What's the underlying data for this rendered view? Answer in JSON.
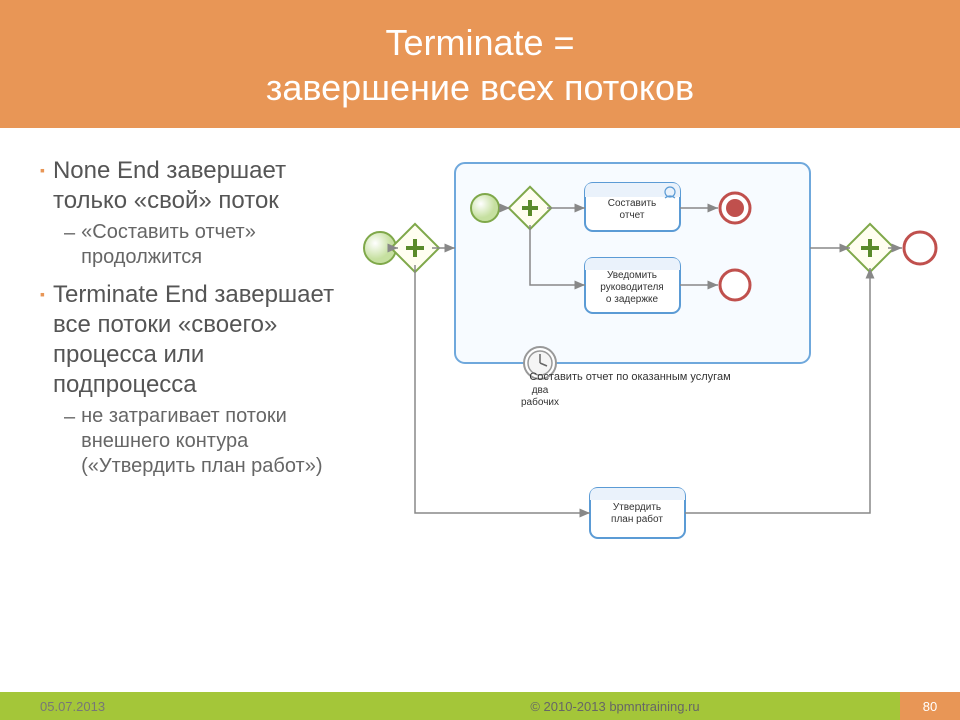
{
  "header": {
    "line1": "Terminate =",
    "line2": "завершение всех потоков"
  },
  "bullets": {
    "b1": "None End завершает только «свой» поток",
    "s1": "«Составить отчет» продолжится",
    "b2": "Terminate End завершает все потоки «своего» процесса или подпроцесса",
    "s2": "не затрагивает потоки внешнего контура («Утвердить план работ»)"
  },
  "diagram": {
    "task1_l1": "Составить",
    "task1_l2": "отчет",
    "task2_l1": "Уведомить",
    "task2_l2": "руководителя",
    "task2_l3": "о задержке",
    "timer_l1": "два",
    "timer_l2": "рабочих",
    "subproc": "Составить отчет по оказанным услугам",
    "task3_l1": "Утвердить",
    "task3_l2": "план работ"
  },
  "footer": {
    "date": "05.07.2013",
    "copy": "© 2010-2013 bpmntraining.ru",
    "page": "80"
  }
}
